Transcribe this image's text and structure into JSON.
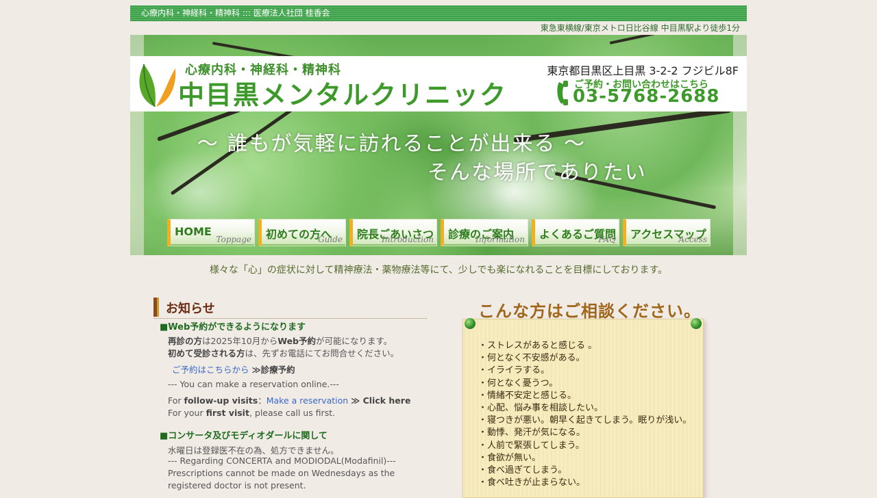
{
  "header": {
    "top_strip": "心療内科・神経科・精神科 ::: 医療法人社団 桂香会",
    "access": "東急東横線/東京メトロ日比谷線 中目黒駅より徒歩1分"
  },
  "logo": {
    "subtitle": "心療内科・神経科・精神科",
    "name": "中目黒メンタルクリニック",
    "address": "東京都目黒区上目黒 3-2-2 フジビル8F",
    "phone_label": "ご予約・お問い合わせはこちら",
    "phone": "03-5768-2688"
  },
  "banner": {
    "tagline1": "〜 誰もが気軽に訪れることが出来る 〜",
    "tagline2": "そんな場所でありたい"
  },
  "nav": [
    {
      "label": "HOME",
      "sub": "Toppage"
    },
    {
      "label": "初めての方へ",
      "sub": "Guide"
    },
    {
      "label": "院長ごあいさつ",
      "sub": "Introduction"
    },
    {
      "label": "診療のご案内",
      "sub": "Information"
    },
    {
      "label": "よくあるご質問",
      "sub": "FAQ"
    },
    {
      "label": "アクセスマップ",
      "sub": "Access"
    }
  ],
  "lead": "様々な「心」の症状に対して精神療法・薬物療法等にて、少しでも楽になれることを目標にしております。",
  "news": {
    "title": "お知らせ",
    "item1": {
      "heading": "■Web予約ができるようになります",
      "line1_b": "再診の方",
      "line1_a": "は2025年10月から",
      "line1_c": "Web予約",
      "line1_d": "が可能になります。",
      "line2_b": "初めて受診される方",
      "line2_a": "は、先ずお電話にてお問合せください。",
      "link_text": "ご予約はこちらから",
      "link_bold": "≫診療予約",
      "en1": "--- You can make a reservation online.---",
      "en2_pre": "For ",
      "en2_b": "follow-up visits",
      "en2_sep": "：",
      "en2_link": "Make a reservation",
      "en2_link_b": "≫ Click here",
      "en3_pre": "For your ",
      "en3_b": "first visit",
      "en3_post": ", please call us first."
    },
    "item2": {
      "heading": "■コンサータ及びモディオダールに関して",
      "line1": "水曜日は登録医不在の為、処方できません。",
      "line2": "--- Regarding CONCERTA and MODIODAL(Modafinil)---",
      "line3": "Prescriptions cannot be made on Wednesdays as the",
      "line4": "registered doctor is not present."
    }
  },
  "consult": {
    "title": "こんな方はご相談ください。",
    "items": [
      "・ストレスがあると感じる 。",
      "・何となく不安感がある。",
      "・イライラする。",
      "・何となく憂うつ。",
      "・情緒不安定と感じる。",
      "・心配、悩み事を相談したい。",
      "・寝つきが悪い。朝早く起きてしまう。眠りが浅い。",
      "・動悸、発汗が気になる。",
      "・人前で緊張してしまう。",
      "・食欲が無い。",
      "・食べ過ぎてしまう。",
      "・食べ吐きが止まらない。"
    ]
  }
}
